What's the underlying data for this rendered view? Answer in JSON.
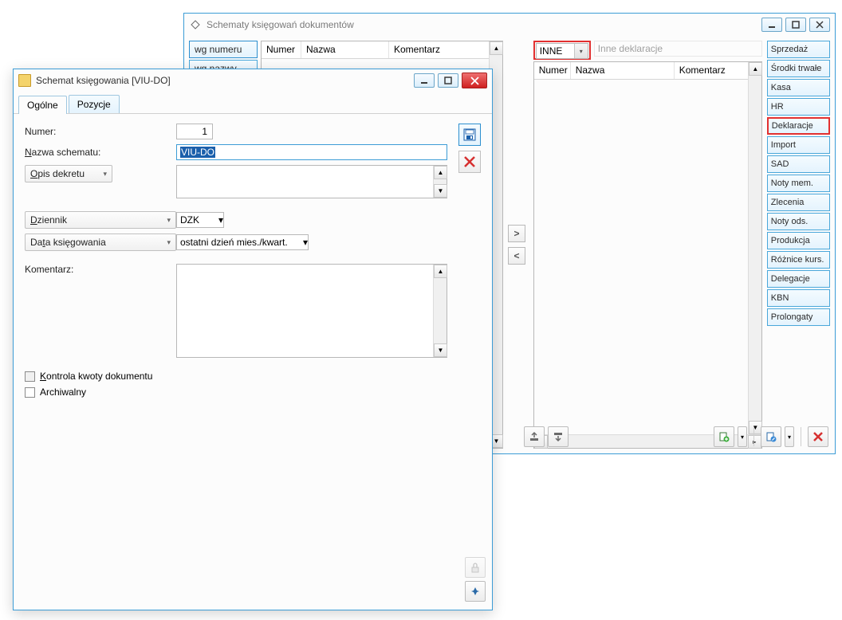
{
  "main": {
    "title": "Schematy księgowań dokumentów",
    "sort_buttons": {
      "wg_numeru": "wg numeru",
      "wg_nazwy": "wg nazwy"
    },
    "left_cols": {
      "numer": "Numer",
      "nazwa": "Nazwa",
      "komentarz": "Komentarz"
    },
    "mid": {
      "right": ">",
      "left": "<"
    },
    "right_top": {
      "dropdown_value": "INNE",
      "desc": "Inne deklaracje"
    },
    "right_cols": {
      "numer": "Numer",
      "nazwa": "Nazwa",
      "komentarz": "Komentarz"
    }
  },
  "side_nav": [
    "Sprzedaż",
    "Środki trwałe",
    "Kasa",
    "HR",
    "Deklaracje",
    "Import",
    "SAD",
    "Noty mem.",
    "Zlecenia",
    "Noty ods.",
    "Produkcja",
    "Różnice kurs.",
    "Delegacje",
    "KBN",
    "Prolongaty"
  ],
  "side_nav_selected": "Deklaracje",
  "dialog": {
    "title": "Schemat księgowania [VIU-DO]",
    "tabs": {
      "ogolne": "Ogólne",
      "pozycje": "Pozycje"
    },
    "labels": {
      "numer": "Numer:",
      "nazwa_schematu": "Nazwa schematu:",
      "opis_dekretu": "Opis dekretu",
      "dziennik": "Dziennik",
      "data_ksiegowania": "Data księgowania",
      "komentarz": "Komentarz:",
      "kontrola_kwoty": "Kontrola kwoty dokumentu",
      "archiwalny": "Archiwalny"
    },
    "values": {
      "numer": "1",
      "nazwa_schematu": "VIU-DO",
      "dziennik": "DZK",
      "data_ksiegowania": "ostatni dzień mies./kwart."
    }
  }
}
